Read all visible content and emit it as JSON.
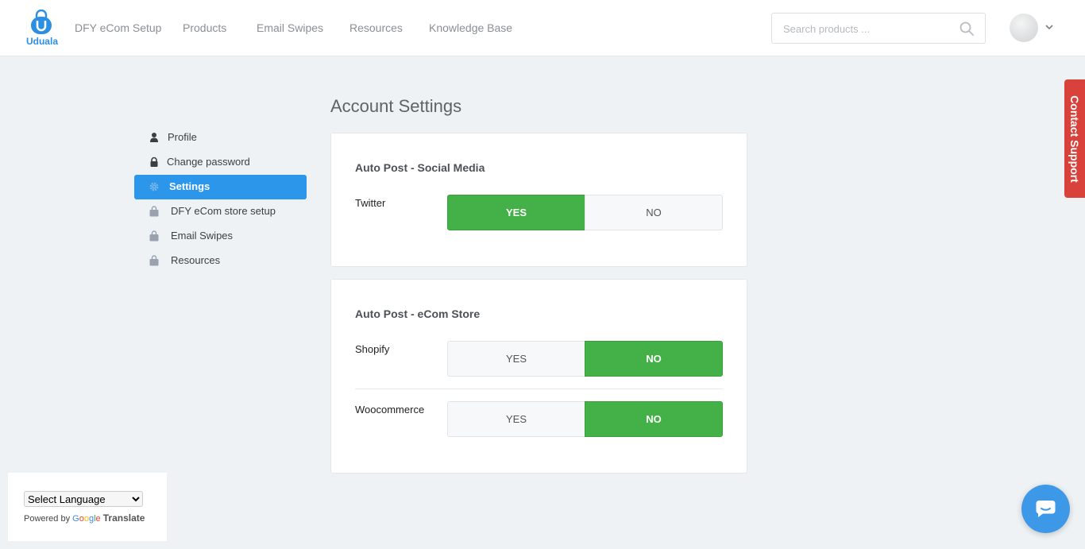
{
  "brand": {
    "name": "Uduala",
    "color": "#2b8fe3"
  },
  "nav": {
    "links": [
      "DFY eCom Setup",
      "Products",
      "Email Swipes",
      "Resources",
      "Knowledge Base"
    ]
  },
  "search": {
    "placeholder": "Search products ...",
    "value": ""
  },
  "sidebar": {
    "items": [
      {
        "label": "Profile",
        "icon": "user-icon"
      },
      {
        "label": "Change password",
        "icon": "lock-icon"
      },
      {
        "label": "Settings",
        "icon": "gear-icon",
        "active": true
      },
      {
        "label": "DFY eCom store setup",
        "icon": "shopping-bag-icon"
      },
      {
        "label": "Email Swipes",
        "icon": "shopping-bag-icon"
      },
      {
        "label": "Resources",
        "icon": "shopping-bag-icon"
      }
    ]
  },
  "main": {
    "title": "Account Settings",
    "social": {
      "title": "Auto Post - Social Media",
      "rows": [
        {
          "label": "Twitter",
          "yes": "YES",
          "no": "NO",
          "selected": "YES"
        }
      ]
    },
    "ecom": {
      "title": "Auto Post - eCom Store",
      "rows": [
        {
          "label": "Shopify",
          "yes": "YES",
          "no": "NO",
          "selected": "NO"
        },
        {
          "label": "Woocommerce",
          "yes": "YES",
          "no": "NO",
          "selected": "NO"
        }
      ]
    }
  },
  "contact_support": {
    "label": "Contact Support",
    "color": "#d9423a"
  },
  "translate": {
    "select_value": "Select Language",
    "powered_by": "Powered by",
    "google": "Google",
    "translate": "Translate"
  },
  "colors": {
    "active": "#2b96ea",
    "toggle_on": "#44b148"
  }
}
